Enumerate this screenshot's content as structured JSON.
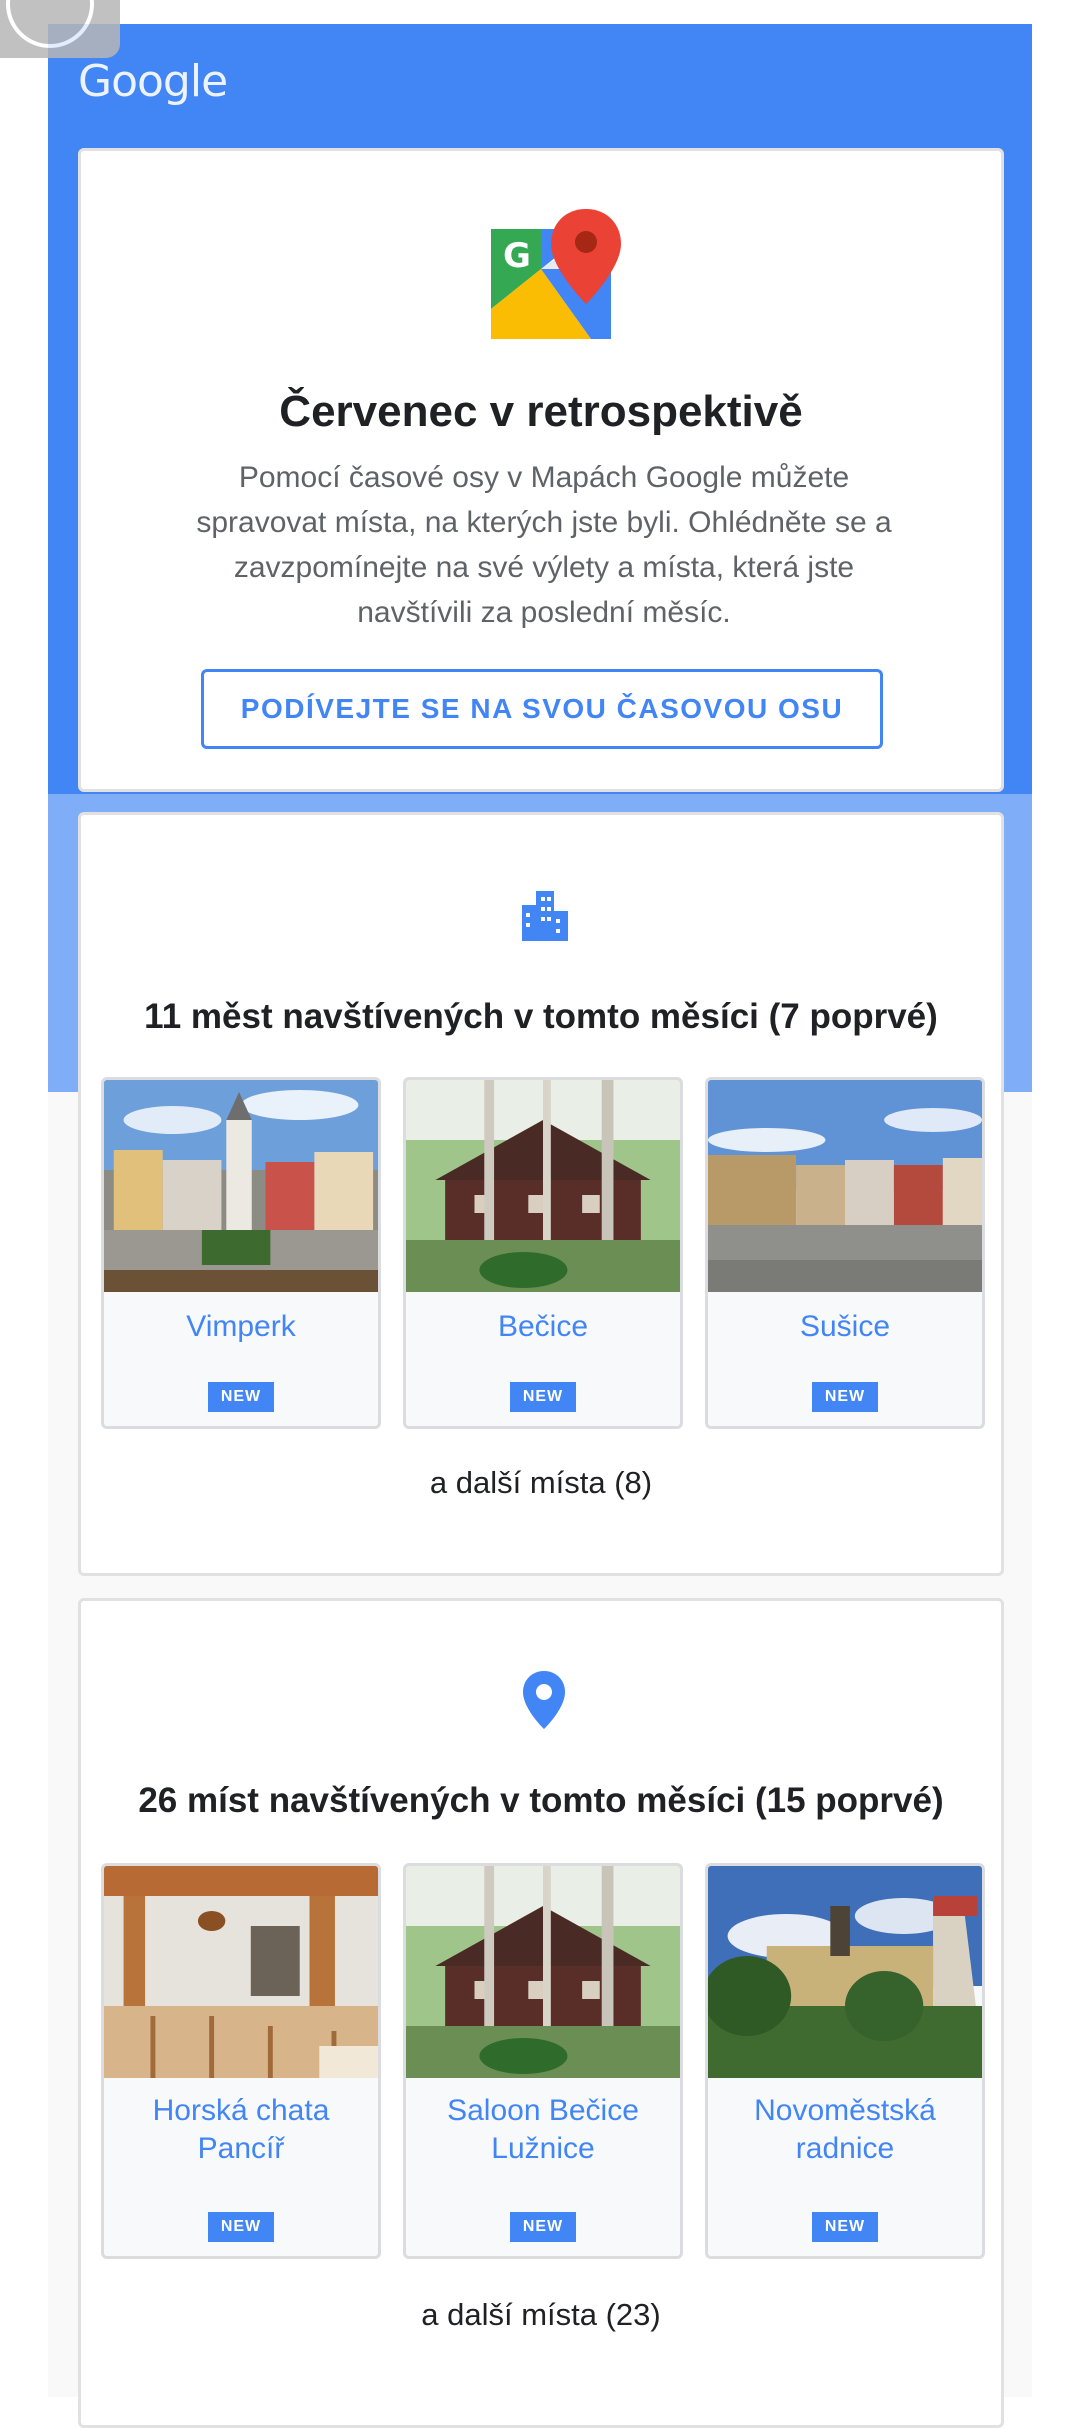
{
  "header": {
    "logo_text": "Google"
  },
  "intro": {
    "title": "Červenec v retrospektivě",
    "text": "Pomocí časové osy v Mapách Google můžete spravovat místa, na kterých jste byli. Ohlédněte se a zavzpomínejte na své výlety a místa, která jste navštívili za poslední měsíc.",
    "button_label": "PODÍVEJTE SE NA SVOU ČASOVOU OSU"
  },
  "cities": {
    "icon": "city-icon",
    "title": "11 měst navštívených v tomto měsíci (7 poprvé)",
    "items": [
      {
        "name": "Vimperk",
        "badge": "NEW"
      },
      {
        "name": "Bečice",
        "badge": "NEW"
      },
      {
        "name": "Sušice",
        "badge": "NEW"
      }
    ],
    "more": "a další místa (8)"
  },
  "places": {
    "icon": "place-pin-icon",
    "title": "26 míst navštívených v tomto měsíci (15 poprvé)",
    "items": [
      {
        "name": "Horská chata Pancíř",
        "badge": "NEW"
      },
      {
        "name": "Saloon Bečice Lužnice",
        "badge": "NEW"
      },
      {
        "name": "Novoměstská radnice",
        "badge": "NEW"
      }
    ],
    "more": "a další místa (23)"
  },
  "colors": {
    "accent": "#4285f4",
    "hero_bg": "#4285f4",
    "hero_bg_light": "#7fadf8"
  }
}
